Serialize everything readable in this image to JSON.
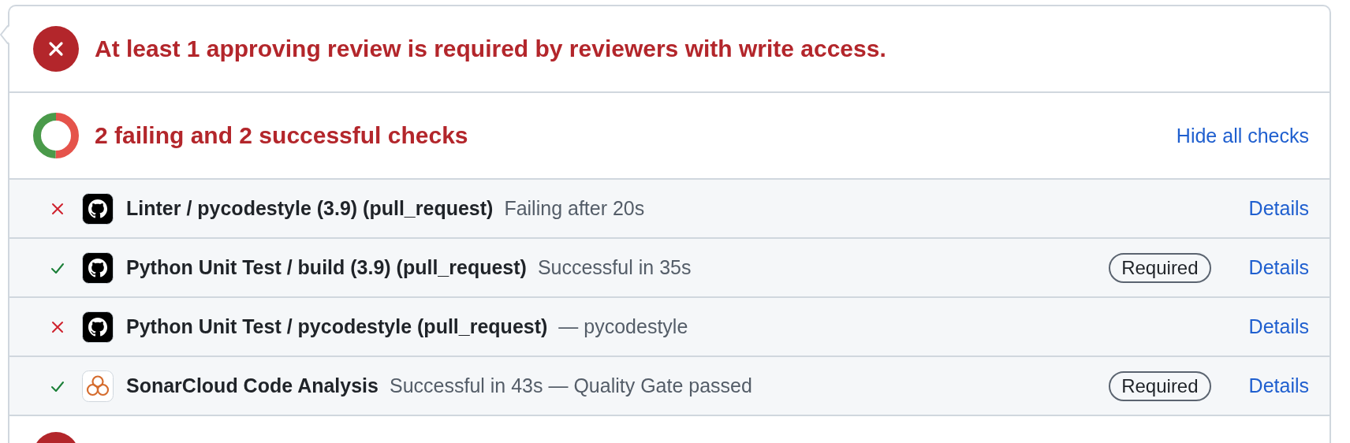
{
  "merge_status": {
    "passed": false,
    "message": "At least 1 approving review is required by reviewers with write access."
  },
  "checks_summary": {
    "title": "2 failing and 2 successful checks",
    "toggle_link": "Hide all checks"
  },
  "checks": [
    {
      "passed": false,
      "kind": "github",
      "name": "Linter / pycodestyle (3.9) (pull_request)",
      "description": "Failing after 20s",
      "details": "Details"
    },
    {
      "passed": true,
      "kind": "github",
      "name": "Python Unit Test / build (3.9) (pull_request)",
      "description": "Successful in 35s",
      "badge": "Required",
      "details": "Details"
    },
    {
      "passed": false,
      "kind": "github",
      "name": "Python Unit Test / pycodestyle (pull_request)",
      "description": "— pycodestyle",
      "details": "Details"
    },
    {
      "passed": true,
      "kind": "sonarcloud",
      "name": "SonarCloud Code Analysis",
      "description": "Successful in 43s — Quality Gate passed",
      "badge": "Required",
      "details": "Details"
    }
  ],
  "next_section": {
    "passed": false
  }
}
